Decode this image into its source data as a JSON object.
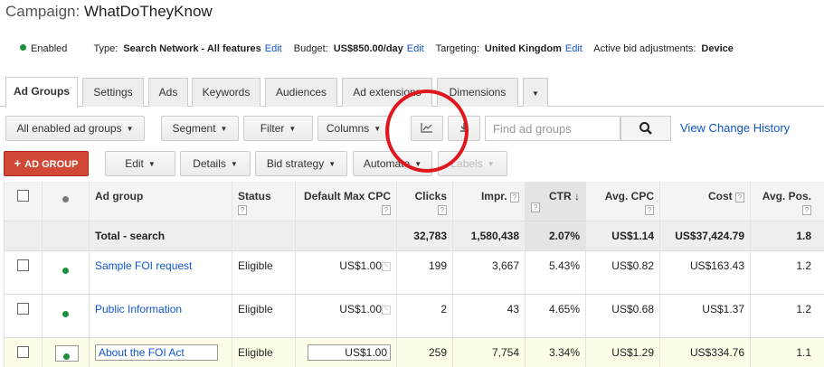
{
  "campaign": {
    "prefix": "Campaign:",
    "name": "WhatDoTheyKnow"
  },
  "info": {
    "status": "Enabled",
    "type_label": "Type:",
    "type_value": "Search Network - All features",
    "budget_label": "Budget:",
    "budget_value": "US$850.00/day",
    "targeting_label": "Targeting:",
    "targeting_value": "United Kingdom",
    "bid_label": "Active bid adjustments:",
    "bid_value": "Device",
    "edit_label": "Edit"
  },
  "tabs": [
    "Ad Groups",
    "Settings",
    "Ads",
    "Keywords",
    "Audiences",
    "Ad extensions",
    "Dimensions"
  ],
  "toolbar1": {
    "filter_select": "All enabled ad groups",
    "segment": "Segment",
    "filter": "Filter",
    "columns": "Columns",
    "search_placeholder": "Find ad groups",
    "change_history": "View Change History"
  },
  "toolbar2": {
    "add": "AD GROUP",
    "edit": "Edit",
    "details": "Details",
    "bid_strategy": "Bid strategy",
    "automate": "Automate",
    "labels": "Labels"
  },
  "table": {
    "headers": {
      "ad_group": "Ad group",
      "status": "Status",
      "max_cpc": "Default Max CPC",
      "clicks": "Clicks",
      "impr": "Impr.",
      "ctr": "CTR",
      "avg_cpc": "Avg. CPC",
      "cost": "Cost",
      "avg_pos": "Avg. Pos."
    },
    "sort_indicator": "↓",
    "total": {
      "label": "Total - search",
      "clicks": "32,783",
      "impr": "1,580,438",
      "ctr": "2.07%",
      "avg_cpc": "US$1.14",
      "cost": "US$37,424.79",
      "avg_pos": "1.8"
    },
    "rows": [
      {
        "name": "Sample FOI request",
        "status": "Eligible",
        "max_cpc": "US$1.00",
        "clicks": "199",
        "impr": "3,667",
        "ctr": "5.43%",
        "avg_cpc": "US$0.82",
        "cost": "US$163.43",
        "avg_pos": "1.2"
      },
      {
        "name": "Public Information",
        "status": "Eligible",
        "max_cpc": "US$1.00",
        "clicks": "2",
        "impr": "43",
        "ctr": "4.65%",
        "avg_cpc": "US$0.68",
        "cost": "US$1.37",
        "avg_pos": "1.2"
      },
      {
        "name": "About the FOI Act",
        "status": "Eligible",
        "max_cpc": "US$1.00",
        "clicks": "259",
        "impr": "7,754",
        "ctr": "3.34%",
        "avg_cpc": "US$1.29",
        "cost": "US$334.76",
        "avg_pos": "1.1"
      }
    ]
  },
  "colors": {
    "accent": "#d14836",
    "link": "#1155cc",
    "enabled": "#1e8e3e",
    "highlight_circle": "#e0181e"
  }
}
